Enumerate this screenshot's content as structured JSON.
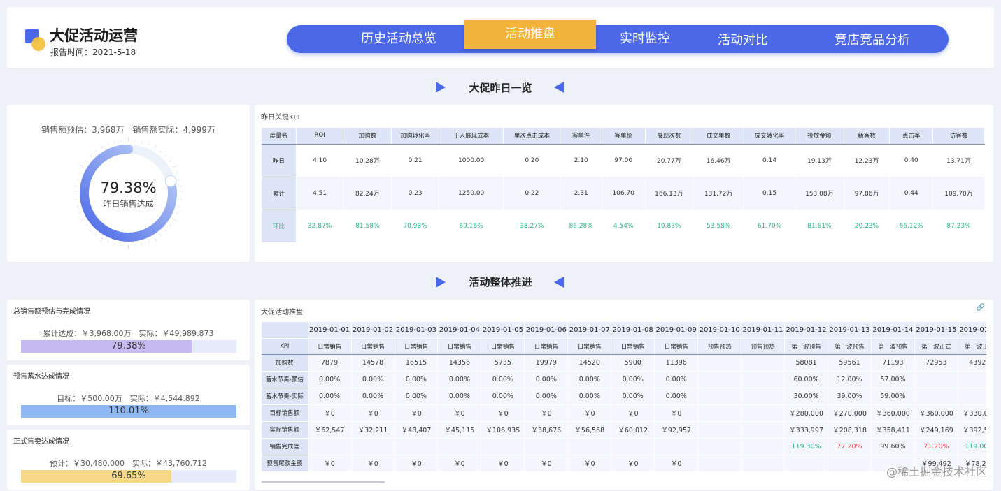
{
  "header": {
    "title": "大促活动运营",
    "report_date": "报告时间：2021-5-18",
    "tabs": [
      {
        "label": "历史活动总览",
        "active": false
      },
      {
        "label": "活动推盘",
        "active": true
      },
      {
        "label": "实时监控",
        "active": false
      },
      {
        "label": "活动对比",
        "active": false
      },
      {
        "label": "竞店竞品分析",
        "active": false
      }
    ]
  },
  "sections": {
    "overview_title": "大促昨日一览",
    "progress_title": "活动整体推进"
  },
  "gauge": {
    "caption": "销售额预估：3,968万　销售额实际：4,999万",
    "percent_text": "79.38%",
    "percent_value": 0.7938,
    "label": "昨日销售达成",
    "colors": {
      "start": "#4a68e8",
      "end": "#b9cff5",
      "track": "#edf1fa"
    }
  },
  "kpi": {
    "panel_title": "昨日关键KPI",
    "headers": [
      "度量名",
      "ROI",
      "加购数",
      "加购转化率",
      "千人展现成本",
      "单次点击成本",
      "客单件",
      "客单价",
      "展现次数",
      "成交单数",
      "成交转化率",
      "投放金额",
      "新客数",
      "点击率",
      "访客数"
    ],
    "rows": [
      {
        "name": "昨日",
        "values": [
          "4.10",
          "10.28万",
          "0.21",
          "1000.00",
          "0.20",
          "2.10",
          "97.00",
          "20.77万",
          "16.46万",
          "0.14",
          "19.13万",
          "12.23万",
          "0.40",
          "13.71万"
        ]
      },
      {
        "name": "累计",
        "values": [
          "4.51",
          "82.24万",
          "0.23",
          "1250.00",
          "0.22",
          "2.31",
          "106.70",
          "166.13万",
          "131.72万",
          "0.15",
          "153.08万",
          "97.86万",
          "0.44",
          "109.70万"
        ]
      },
      {
        "name": "环比",
        "values": [
          "32.87%",
          "81.58%",
          "70.98%",
          "69.16%",
          "38.27%",
          "86.28%",
          "4.54%",
          "10.83%",
          "53.58%",
          "61.70%",
          "81.61%",
          "20.23%",
          "66.12%",
          "87.23%"
        ]
      }
    ]
  },
  "progress_panels": [
    {
      "title": "总销售额预估与完成情况",
      "sub": "累计达成：￥3,968.00万　实际：￥49,989.873",
      "value_text": "79.38%",
      "value": 0.7938,
      "color": "#c7b9f3"
    },
    {
      "title": "预售蓄水达成情况",
      "sub": "目标：￥500.00万　实际：￥4,544.892",
      "value_text": "110.01%",
      "value": 1.1001,
      "color": "#8fb8f3"
    },
    {
      "title": "正式售卖达成情况",
      "sub": "预计：￥30,480.000　实际：￥43,760.712",
      "value_text": "69.65%",
      "value": 0.6965,
      "color": "#f7d886"
    }
  ],
  "plan": {
    "panel_title": "大促活动推盘",
    "link_icon": "link-icon",
    "kpi_header": "KPI",
    "dates": [
      "2019-01-01",
      "2019-01-02",
      "2019-01-03",
      "2019-01-04",
      "2019-01-05",
      "2019-01-06",
      "2019-01-07",
      "2019-01-08",
      "2019-01-09",
      "2019-01-10",
      "2019-01-11",
      "2019-01-12",
      "2019-01-13",
      "2019-01-14",
      "2019-01-15",
      "2019-01-16",
      "20"
    ],
    "stages": [
      "日常销售",
      "日常销售",
      "日常销售",
      "日常销售",
      "日常销售",
      "日常销售",
      "日常销售",
      "日常销售",
      "日常销售",
      "预售预热",
      "预售预热",
      "第一波预售",
      "第一波预售",
      "第一波预售",
      "第一波正式",
      "第一波正式",
      "第"
    ],
    "rows": [
      {
        "name": "加购数",
        "values": [
          "7879",
          "14578",
          "16515",
          "14356",
          "5735",
          "19979",
          "14520",
          "5900",
          "11396",
          "",
          "",
          "58081",
          "59561",
          "71193",
          "72953",
          "43926",
          ""
        ]
      },
      {
        "name": "蓄水节奏-预估",
        "values": [
          "0.00%",
          "0.00%",
          "0.00%",
          "0.00%",
          "0.00%",
          "0.00%",
          "0.00%",
          "0.00%",
          "0.00%",
          "",
          "",
          "60.00%",
          "12.00%",
          "57.00%",
          "",
          "",
          ""
        ]
      },
      {
        "name": "蓄水节奏-实际",
        "values": [
          "0.00%",
          "0.00%",
          "0.00%",
          "0.00%",
          "0.00%",
          "0.00%",
          "0.00%",
          "0.00%",
          "0.00%",
          "",
          "",
          "30.00%",
          "39.00%",
          "59.00%",
          "",
          "",
          ""
        ]
      },
      {
        "name": "目标销售额",
        "values": [
          "￥0",
          "￥0",
          "￥0",
          "￥0",
          "￥0",
          "￥0",
          "￥0",
          "￥0",
          "￥0",
          "",
          "",
          "￥280,000",
          "￥270,000",
          "￥360,000",
          "￥360,000",
          "￥330,000",
          "￥"
        ]
      },
      {
        "name": "实际销售额",
        "values": [
          "￥62,547",
          "￥32,211",
          "￥48,407",
          "￥45,115",
          "￥106,935",
          "￥38,676",
          "￥56,568",
          "￥60,012",
          "￥92,957",
          "",
          "",
          "￥333,997",
          "￥208,318",
          "￥358,411",
          "￥249,169",
          "￥392,552",
          "￥"
        ]
      },
      {
        "name": "销售完成度",
        "values": [
          "",
          "",
          "",
          "",
          "",
          "",
          "",
          "",
          "",
          "",
          "",
          "119.30%",
          "77.20%",
          "99.60%",
          "71.20%",
          "119.00%",
          "9"
        ],
        "colors": [
          "",
          "",
          "",
          "",
          "",
          "",
          "",
          "",
          "",
          "",
          "",
          "green",
          "red",
          "",
          "red",
          "green",
          ""
        ]
      },
      {
        "name": "预售尾款金额",
        "values": [
          "￥0",
          "￥0",
          "￥0",
          "￥0",
          "￥0",
          "￥0",
          "￥0",
          "￥0",
          "￥0",
          "",
          "",
          "",
          "",
          "",
          "￥99,492",
          "￥78,259",
          "￥"
        ]
      }
    ]
  },
  "watermark": "@稀土掘金技术社区"
}
